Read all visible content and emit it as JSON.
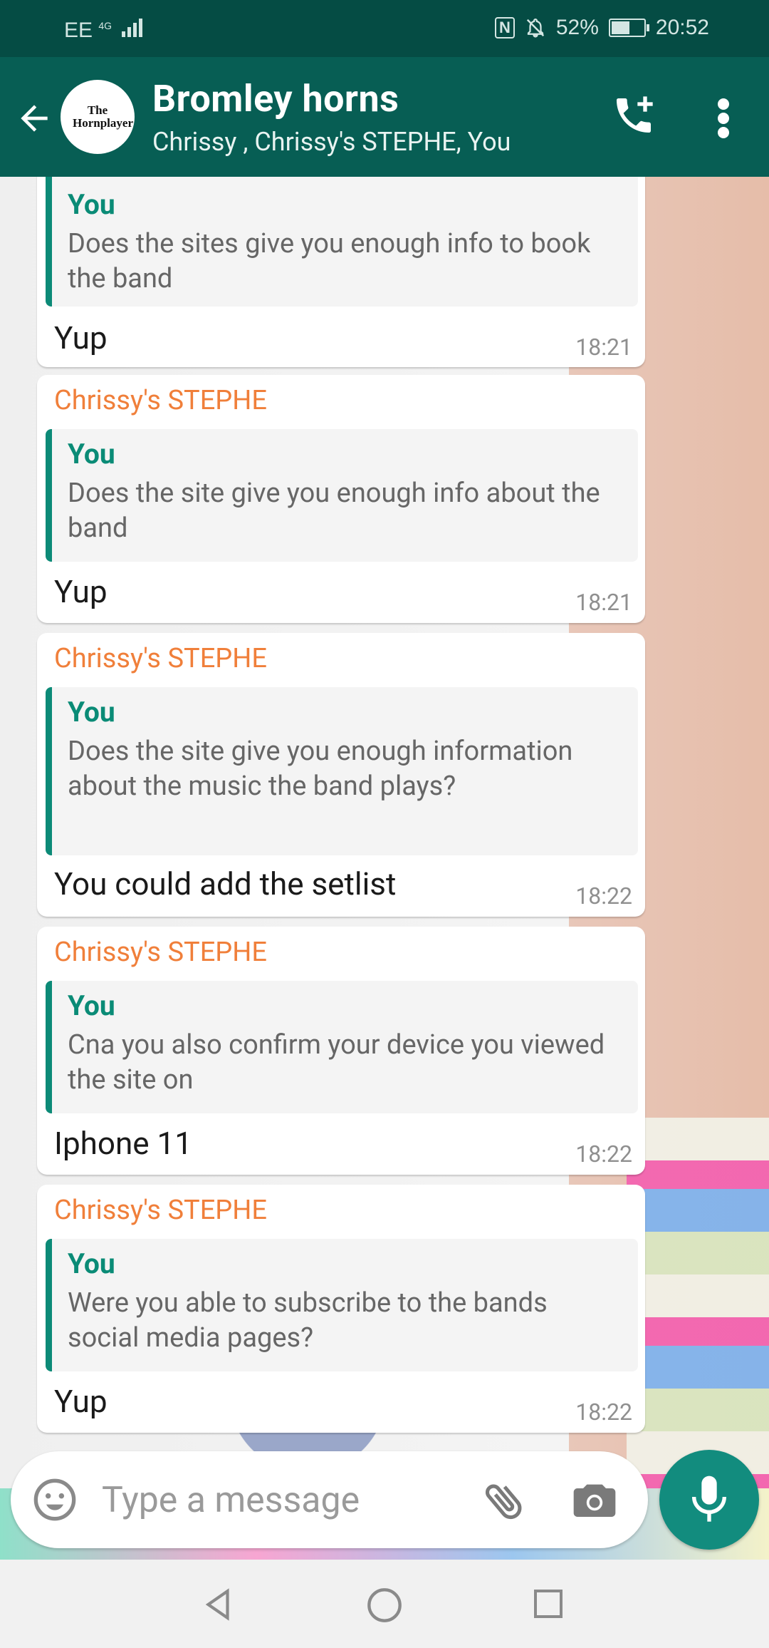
{
  "status_bar": {
    "carrier": "EE",
    "network": "4G",
    "battery": "52%",
    "time": "20:52"
  },
  "header": {
    "title": "Bromley horns",
    "subtitle": "Chrissy , Chrissy's STEPHE, You",
    "avatar_text": "The Hornplayer"
  },
  "messages": [
    {
      "sender": "",
      "quote_name": "You",
      "quote_text": "Does the sites give you enough info to book the band",
      "text": "Yup",
      "time": "18:21"
    },
    {
      "sender": "Chrissy's STEPHE",
      "quote_name": "You",
      "quote_text": "Does the site give you enough info about the band",
      "text": "Yup",
      "time": "18:21"
    },
    {
      "sender": "Chrissy's STEPHE",
      "quote_name": "You",
      "quote_text": "Does the site give you enough information about the music the band plays?",
      "text": "You could add the setlist",
      "time": "18:22"
    },
    {
      "sender": "Chrissy's STEPHE",
      "quote_name": "You",
      "quote_text": "Cna you also confirm your device you viewed the site on",
      "text": "Iphone 11",
      "time": "18:22"
    },
    {
      "sender": "Chrissy's STEPHE",
      "quote_name": "You",
      "quote_text": "Were you able to subscribe to the bands social media pages?",
      "text": "Yup",
      "time": "18:22"
    }
  ],
  "input": {
    "placeholder": "Type a message"
  },
  "icons": {
    "back": "arrow-left-icon",
    "call": "add-call-icon",
    "menu": "more-vert-icon",
    "emoji": "emoji-icon",
    "attach": "paperclip-icon",
    "camera": "camera-icon",
    "mic": "mic-icon"
  },
  "colors": {
    "header": "#075e54",
    "accent": "#128c7e",
    "sender": "#f07f3a",
    "quote": "#0a8b76"
  }
}
